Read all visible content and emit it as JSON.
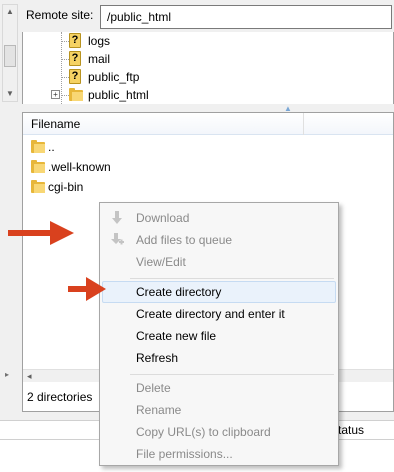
{
  "remote_site": {
    "label": "Remote site:",
    "path": "/public_html"
  },
  "tree": {
    "items": [
      {
        "label": "logs",
        "icon": "unknown-folder-icon"
      },
      {
        "label": "mail",
        "icon": "unknown-folder-icon"
      },
      {
        "label": "public_ftp",
        "icon": "unknown-folder-icon"
      },
      {
        "label": "public_html",
        "icon": "folder-icon",
        "expander": "+"
      }
    ]
  },
  "file_list": {
    "column_header": "Filename",
    "rows": [
      {
        "name": ".."
      },
      {
        "name": ".well-known"
      },
      {
        "name": "cgi-bin"
      }
    ],
    "status": "2 directories"
  },
  "queue": {
    "column_status": "Status"
  },
  "context_menu": {
    "items": [
      {
        "label": "Download",
        "enabled": false,
        "icon": "download-arrow-icon"
      },
      {
        "label": "Add files to queue",
        "enabled": false,
        "icon": "add-to-queue-icon"
      },
      {
        "label": "View/Edit",
        "enabled": false
      },
      {
        "label": "Create directory",
        "enabled": true,
        "highlighted": true
      },
      {
        "label": "Create directory and enter it",
        "enabled": true
      },
      {
        "label": "Create new file",
        "enabled": true
      },
      {
        "label": "Refresh",
        "enabled": true
      },
      {
        "label": "Delete",
        "enabled": false
      },
      {
        "label": "Rename",
        "enabled": false
      },
      {
        "label": "Copy URL(s) to clipboard",
        "enabled": false
      },
      {
        "label": "File permissions...",
        "enabled": false
      }
    ]
  },
  "colors": {
    "annotation_arrow": "#d9411e",
    "menu_highlight": "#eaf2fb",
    "folder": "#e7b73a"
  }
}
